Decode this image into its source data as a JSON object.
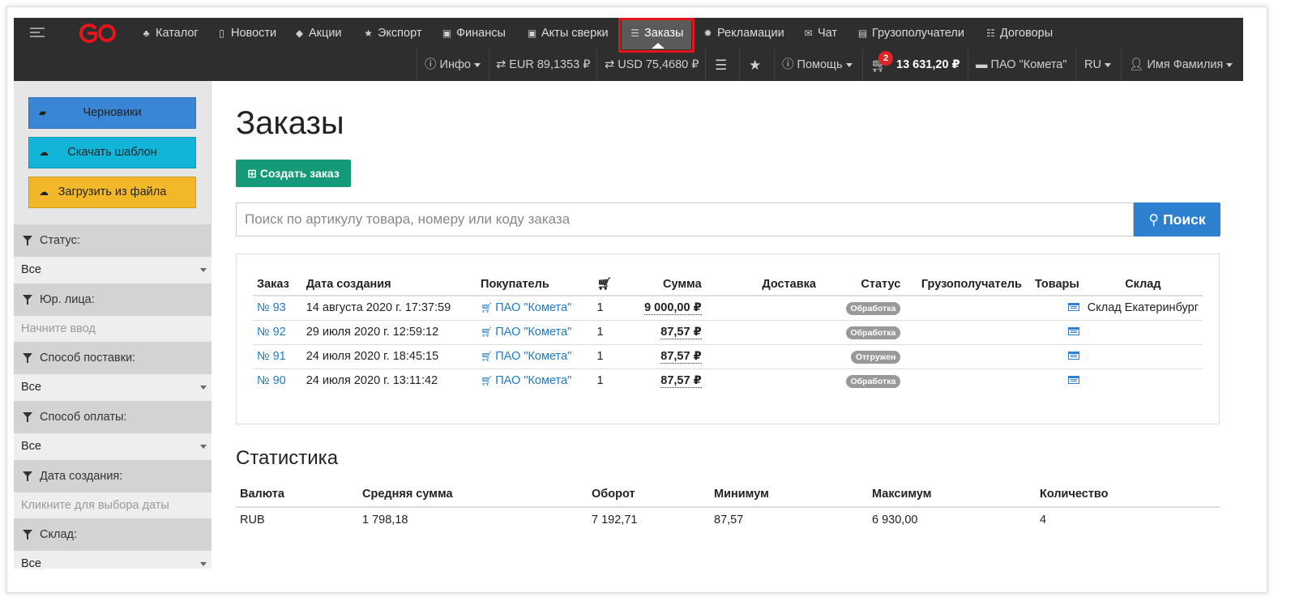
{
  "nav": {
    "items": [
      {
        "label": "Каталог",
        "icon": "sitemap-icon"
      },
      {
        "label": "Новости",
        "icon": "file-icon"
      },
      {
        "label": "Акции",
        "icon": "tags-icon"
      },
      {
        "label": "Экспорт",
        "icon": "star-icon"
      },
      {
        "label": "Финансы",
        "icon": "money-icon"
      },
      {
        "label": "Акты сверки",
        "icon": "money-icon"
      },
      {
        "label": "Заказы",
        "icon": "list-icon",
        "active": true
      },
      {
        "label": "Рекламации",
        "icon": "certificate-icon"
      },
      {
        "label": "Чат",
        "icon": "envelope-icon"
      },
      {
        "label": "Грузополучатели",
        "icon": "archive-icon"
      },
      {
        "label": "Договоры",
        "icon": "list-alt-icon"
      }
    ],
    "row2": {
      "info": "Инфо",
      "eur": "EUR 89,1353 ₽",
      "usd": "USD 75,4680 ₽",
      "help": "Помощь",
      "cart_count": "2",
      "cart_total": "13 631,20 ₽",
      "company": "ПАО \"Комета\"",
      "lang": "RU",
      "user": "Имя Фамилия"
    },
    "brand_color": "#e8141b"
  },
  "sidebar": {
    "buttons": [
      {
        "label": "Черновики",
        "color": "#3a86d6"
      },
      {
        "label": "Скачать шаблон",
        "color": "#12b5d8"
      },
      {
        "label": "Загрузить из файла",
        "color": "#f2b829"
      }
    ],
    "filters": [
      {
        "label": "Статус:",
        "value": "Все",
        "placeholder": false
      },
      {
        "label": "Юр. лица:",
        "value": "Начните ввод",
        "placeholder": true
      },
      {
        "label": "Способ поставки:",
        "value": "Все",
        "placeholder": false
      },
      {
        "label": "Способ оплаты:",
        "value": "Все",
        "placeholder": false
      },
      {
        "label": "Дата создания:",
        "value": "Кликните для выбора даты",
        "placeholder": true
      },
      {
        "label": "Склад:",
        "value": "Все",
        "placeholder": false
      }
    ]
  },
  "main": {
    "title": "Заказы",
    "create_label": "Создать заказ",
    "search_placeholder": "Поиск по артикулу товара, номеру или коду заказа",
    "search_button": "Поиск",
    "orders": {
      "columns": [
        "Заказ",
        "Дата создания",
        "Покупатель",
        "",
        "Сумма",
        "Доставка",
        "Статус",
        "Грузополучатель",
        "Товары",
        "Склад"
      ],
      "rows": [
        {
          "id": "№ 93",
          "date": "14 августа 2020 г. 17:37:59",
          "buyer": "ПАО \"Комета\"",
          "qty": "1",
          "sum": "9 000,00 ₽",
          "delivery": "",
          "status": "Обработка",
          "consignee": "",
          "warehouse": "Склад Екатеринбург"
        },
        {
          "id": "№ 92",
          "date": "29 июля 2020 г. 12:59:12",
          "buyer": "ПАО \"Комета\"",
          "qty": "1",
          "sum": "87,57 ₽",
          "delivery": "",
          "status": "Обработка",
          "consignee": "",
          "warehouse": ""
        },
        {
          "id": "№ 91",
          "date": "24 июля 2020 г. 18:45:15",
          "buyer": "ПАО \"Комета\"",
          "qty": "1",
          "sum": "87,57 ₽",
          "delivery": "",
          "status": "Отгружен",
          "consignee": "",
          "warehouse": ""
        },
        {
          "id": "№ 90",
          "date": "24 июля 2020 г. 13:11:42",
          "buyer": "ПАО \"Комета\"",
          "qty": "1",
          "sum": "87,57 ₽",
          "delivery": "",
          "status": "Обработка",
          "consignee": "",
          "warehouse": ""
        }
      ]
    },
    "stats": {
      "title": "Статистика",
      "columns": [
        "Валюта",
        "Средняя сумма",
        "Оборот",
        "Минимум",
        "Максимум",
        "Количество"
      ],
      "rows": [
        [
          "RUB",
          "1 798,18",
          "7 192,71",
          "87,57",
          "6 930,00",
          "4"
        ]
      ]
    }
  }
}
